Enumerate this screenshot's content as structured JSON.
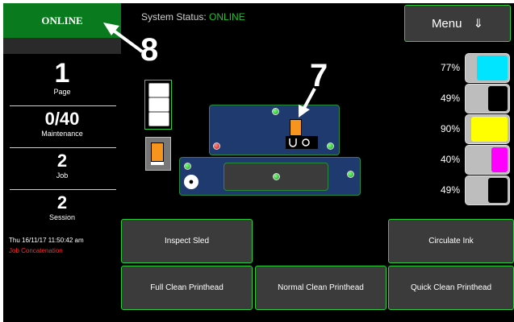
{
  "status_badge": "ONLINE",
  "header": {
    "status_label": "System Status:",
    "status_value": "ONLINE",
    "menu_label": "Menu",
    "menu_icon": "⇓"
  },
  "annotations": {
    "eight": "8",
    "seven": "7"
  },
  "counters": [
    {
      "value": "1",
      "label": "Page"
    },
    {
      "value": "0/40",
      "label": "Maintenance"
    },
    {
      "value": "2",
      "label": "Job"
    },
    {
      "value": "2",
      "label": "Session"
    }
  ],
  "datetime": "Thu 16/11/17 11:50:42 am",
  "job_mode": "Job Concatenation",
  "ink_levels": [
    {
      "percent": "77%",
      "level": 0.77,
      "color": "#00e5ff"
    },
    {
      "percent": "49%",
      "level": 0.49,
      "color": "#000000"
    },
    {
      "percent": "90%",
      "level": 0.9,
      "color": "#ffff00"
    },
    {
      "percent": "40%",
      "level": 0.4,
      "color": "#ff00ff"
    },
    {
      "percent": "49%",
      "level": 0.49,
      "color": "#000000"
    }
  ],
  "buttons": {
    "inspect_sled": "Inspect Sled",
    "circulate_ink": "Circulate Ink",
    "full_clean": "Full Clean Printhead",
    "normal_clean": "Normal Clean Printhead",
    "quick_clean": "Quick Clean Printhead"
  },
  "colors": {
    "accent": "#2bd03c",
    "online_bg": "#0a7a1f",
    "sled": "#1e3a6e",
    "cartridge": "#f7941d"
  }
}
